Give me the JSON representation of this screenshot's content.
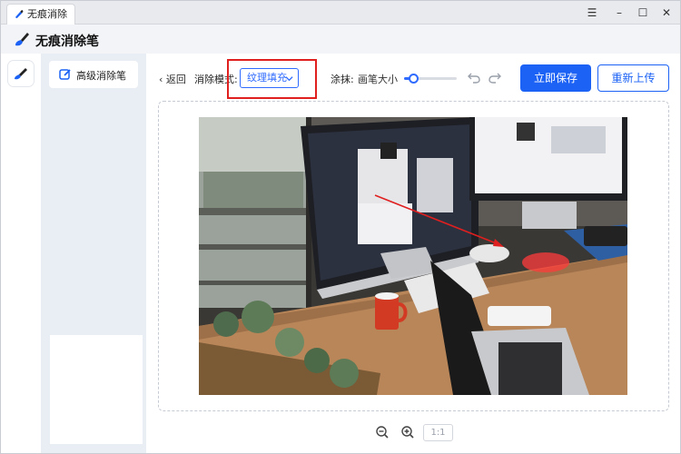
{
  "window": {
    "tab_title": "无痕消除笔",
    "controls": {
      "menu": "☰",
      "minimize": "–",
      "maximize": "☐",
      "close": "✕"
    }
  },
  "app": {
    "title": "无痕消除笔"
  },
  "sidebar": {
    "items": [
      {
        "label": "高级消除笔",
        "icon": "edit-icon"
      }
    ]
  },
  "toolbar": {
    "back_label": "返回",
    "mode_label": "消除模式:",
    "mode_value": "纹理填充",
    "brush_label": "涂抹:",
    "size_label": "画笔大小",
    "brush_size_fraction": 0.18,
    "save_label": "立即保存",
    "reupload_label": "重新上传"
  },
  "zoom": {
    "ratio_label": "1:1"
  },
  "colors": {
    "accent": "#1c62f5",
    "highlight": "#e01f1f",
    "brush_mark": "#ff3b3b"
  }
}
